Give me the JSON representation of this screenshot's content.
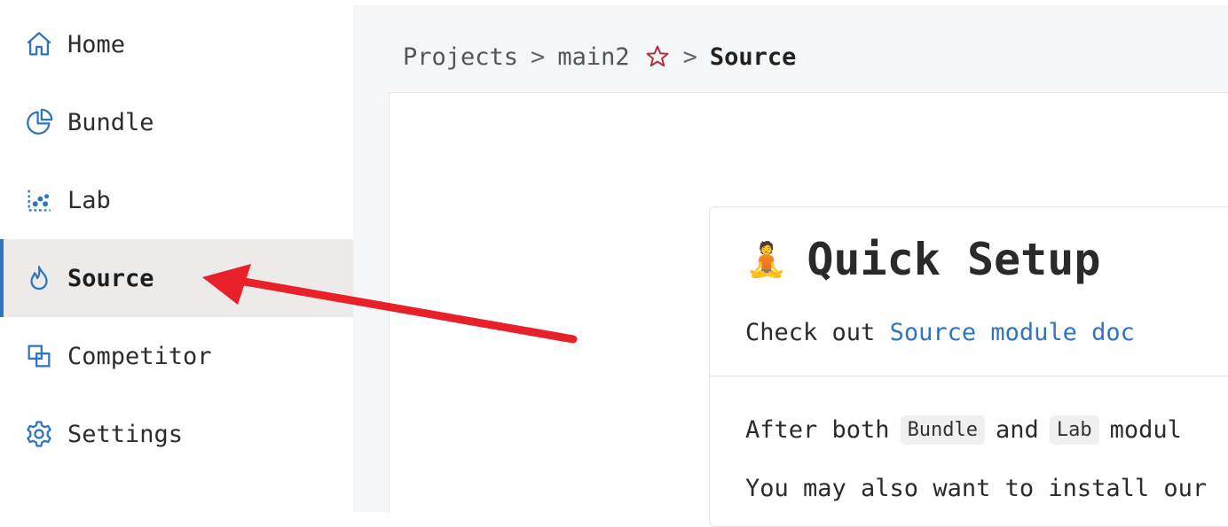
{
  "sidebar": {
    "items": [
      {
        "label": "Home",
        "icon": "home-icon"
      },
      {
        "label": "Bundle",
        "icon": "pie-chart-icon"
      },
      {
        "label": "Lab",
        "icon": "scatter-chart-icon"
      },
      {
        "label": "Source",
        "icon": "flame-icon",
        "active": true
      },
      {
        "label": "Competitor",
        "icon": "overlap-squares-icon"
      },
      {
        "label": "Settings",
        "icon": "gear-icon"
      }
    ]
  },
  "breadcrumb": {
    "root": "Projects",
    "separator": ">",
    "project": "main2",
    "current": "Source"
  },
  "card": {
    "emoji": "🧘",
    "title": "Quick Setup",
    "intro_text": "Check out ",
    "link_text": "Source module doc",
    "body_line1_prefix": "After both",
    "body_chip1": "Bundle",
    "body_line1_mid": "and",
    "body_chip2": "Lab",
    "body_line1_suffix": "modul",
    "body_line2": "You may also want to install our"
  },
  "colors": {
    "accent": "#2f74c0",
    "active_bg": "#ecebea",
    "star": "#b0303a",
    "annotation_arrow": "#e8202a"
  }
}
